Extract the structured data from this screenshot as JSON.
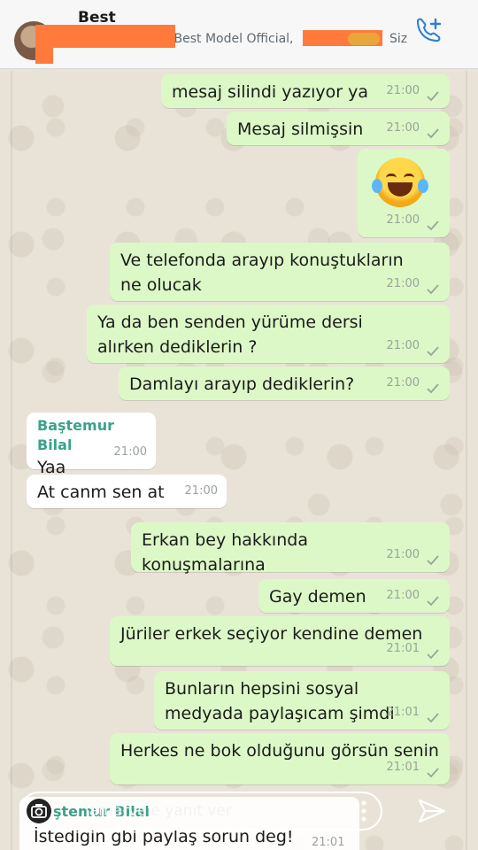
{
  "header": {
    "chat_title": "Best",
    "participants_visible": "re Best Model Official,",
    "participants_tail": "Siz"
  },
  "messages": [
    {
      "direction": "out",
      "text": "mesaj silindi yazıyor ya",
      "time": "21:00"
    },
    {
      "direction": "out",
      "text": "Mesaj silmişsin",
      "time": "21:00"
    },
    {
      "direction": "out",
      "emoji": "face-with-tears-of-joy",
      "time": "21:00"
    },
    {
      "direction": "out",
      "text": "Ve telefonda arayıp konuştukların ne olucak",
      "time": "21:00"
    },
    {
      "direction": "out",
      "text": "Ya da ben senden yürüme dersi alırken dediklerin ?",
      "time": "21:00"
    },
    {
      "direction": "out",
      "text": "Damlayı arayıp dediklerin?",
      "time": "21:00"
    },
    {
      "direction": "in",
      "sender": "Baştemur Bilal",
      "text": "Yaa",
      "time": "21:00"
    },
    {
      "direction": "in",
      "text": "At canm sen at",
      "time": "21:00"
    },
    {
      "direction": "out",
      "text": "Erkan bey hakkında konuşmalarına",
      "time": "21:00"
    },
    {
      "direction": "out",
      "text": "Gay demen",
      "time": "21:00"
    },
    {
      "direction": "out",
      "text": "Jüriler erkek seçiyor kendine demen",
      "time": "21:01"
    },
    {
      "direction": "out",
      "text": "Bunların hepsini sosyal medyada paylaşıcam şimdi",
      "time": "21:01"
    },
    {
      "direction": "out",
      "text": "Herkes ne bok olduğunu görsün senin",
      "time": "21:01"
    },
    {
      "direction": "in",
      "sender": "Baştemur Bilal",
      "text": "İstedigin gbi paylaş sorun deg!",
      "time": "21:01"
    }
  ],
  "reply_bar": {
    "placeholder": "iamerve'e yanıt ver",
    "tail_sender": "ştemur Bilal"
  },
  "colors": {
    "outgoing_bubble": "#dcf8c6",
    "incoming_bubble": "#ffffff",
    "sender_name": "#3aa28b",
    "redaction": "#ff7a3b",
    "call_icon": "#2b7fd6"
  },
  "icons": {
    "call": "add-call-icon",
    "camera": "camera-icon",
    "send": "send-icon",
    "more": "more-vertical-icon"
  }
}
